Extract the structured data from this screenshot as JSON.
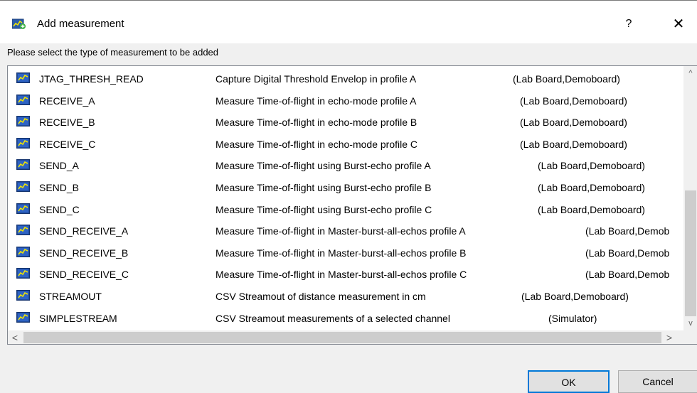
{
  "window": {
    "title": "Add measurement",
    "help_label": "?",
    "close_label": "✕"
  },
  "prompt": "Please select the type of measurement to be added",
  "measurements": [
    {
      "name": "JTAG_THRESH_READ",
      "description": "Capture Digital Threshold Envelop in profile A",
      "boards": "(Lab Board,Demoboard)"
    },
    {
      "name": "RECEIVE_A",
      "description": "Measure Time-of-flight in echo-mode profile A",
      "boards": "(Lab Board,Demoboard)"
    },
    {
      "name": "RECEIVE_B",
      "description": "Measure Time-of-flight in echo-mode profile B",
      "boards": "(Lab Board,Demoboard)"
    },
    {
      "name": "RECEIVE_C",
      "description": "Measure Time-of-flight in echo-mode profile C",
      "boards": "(Lab Board,Demoboard)"
    },
    {
      "name": "SEND_A",
      "description": "Measure Time-of-flight using Burst-echo profile A",
      "boards": "(Lab Board,Demoboard)"
    },
    {
      "name": "SEND_B",
      "description": "Measure Time-of-flight using Burst-echo profile B",
      "boards": "(Lab Board,Demoboard)"
    },
    {
      "name": "SEND_C",
      "description": "Measure Time-of-flight using Burst-echo profile C",
      "boards": "(Lab Board,Demoboard)"
    },
    {
      "name": "SEND_RECEIVE_A",
      "description": "Measure Time-of-flight in Master-burst-all-echos profile A",
      "boards": "(Lab Board,Demob"
    },
    {
      "name": "SEND_RECEIVE_B",
      "description": "Measure Time-of-flight in Master-burst-all-echos profile B",
      "boards": "(Lab Board,Demob"
    },
    {
      "name": "SEND_RECEIVE_C",
      "description": "Measure Time-of-flight in Master-burst-all-echos profile C",
      "boards": "(Lab Board,Demob"
    },
    {
      "name": "STREAMOUT",
      "description": "CSV Streamout of distance measurement in cm",
      "boards": "(Lab Board,Demoboard)"
    },
    {
      "name": "SIMPLESTREAM",
      "description": "CSV Streamout measurements of a selected channel",
      "boards": "(Simulator)"
    }
  ],
  "buttons": {
    "ok": "OK",
    "cancel": "Cancel"
  },
  "icons": {
    "app": "measurement-add-icon",
    "row": "measurement-chart-icon"
  },
  "colors": {
    "accent": "#0078d7",
    "icon_blue": "#1e4a9c",
    "icon_line": "#f2e600"
  }
}
